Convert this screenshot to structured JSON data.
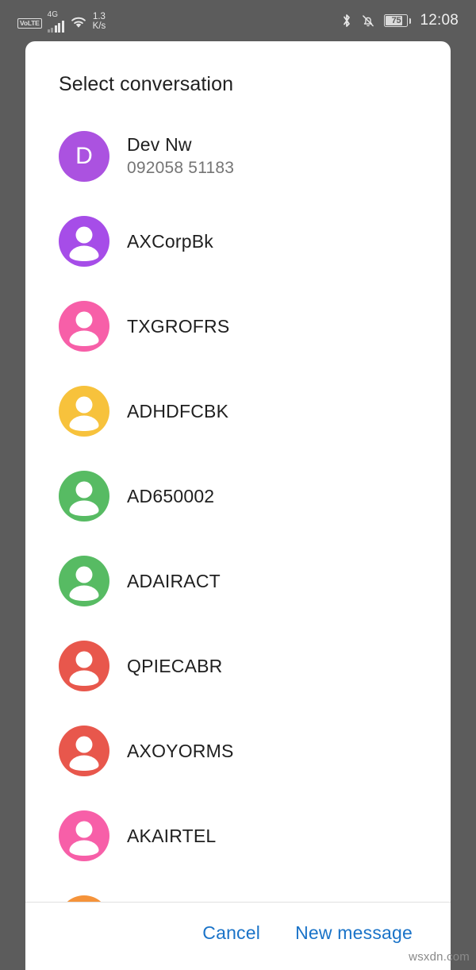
{
  "status_bar": {
    "volte_label": "VoLTE",
    "network_type": "4G",
    "network_speed_value": "1.3",
    "network_speed_unit": "K/s",
    "wifi_icon": "wifi-icon",
    "bluetooth_icon": "bluetooth-icon",
    "mute_icon": "bell-muted-icon",
    "battery_level": "75",
    "time": "12:08"
  },
  "dialog": {
    "title": "Select conversation",
    "actions": {
      "cancel_label": "Cancel",
      "new_message_label": "New message"
    },
    "conversations": [
      {
        "name": "Dev Nw",
        "subtitle": "092058 51183",
        "avatar_type": "initial",
        "initial": "D",
        "color": "#AB52E0"
      },
      {
        "name": "AXCorpBk",
        "subtitle": "",
        "avatar_type": "person",
        "initial": "",
        "color": "#A64DE8"
      },
      {
        "name": "TXGROFRS",
        "subtitle": "",
        "avatar_type": "person",
        "initial": "",
        "color": "#F75FA8"
      },
      {
        "name": "ADHDFCBK",
        "subtitle": "",
        "avatar_type": "person",
        "initial": "",
        "color": "#F7C23C"
      },
      {
        "name": "AD650002",
        "subtitle": "",
        "avatar_type": "person",
        "initial": "",
        "color": "#57BB63"
      },
      {
        "name": "ADAIRACT",
        "subtitle": "",
        "avatar_type": "person",
        "initial": "",
        "color": "#57BB63"
      },
      {
        "name": "QPIECABR",
        "subtitle": "",
        "avatar_type": "person",
        "initial": "",
        "color": "#E8574C"
      },
      {
        "name": "AXOYORMS",
        "subtitle": "",
        "avatar_type": "person",
        "initial": "",
        "color": "#E8574C"
      },
      {
        "name": "AKAIRTEL",
        "subtitle": "",
        "avatar_type": "person",
        "initial": "",
        "color": "#F75FA8"
      },
      {
        "name": "",
        "subtitle": "",
        "avatar_type": "person",
        "initial": "",
        "color": "#F5933A"
      }
    ]
  },
  "watermark": "wsxdn.com",
  "colors": {
    "scrim": "#5c5c5c",
    "dialog_bg": "#ffffff",
    "accent_link": "#1a73c8",
    "title_text": "#212121",
    "primary_text": "#1f1f1f",
    "secondary_text": "#757575",
    "divider": "#e0e0e0"
  }
}
